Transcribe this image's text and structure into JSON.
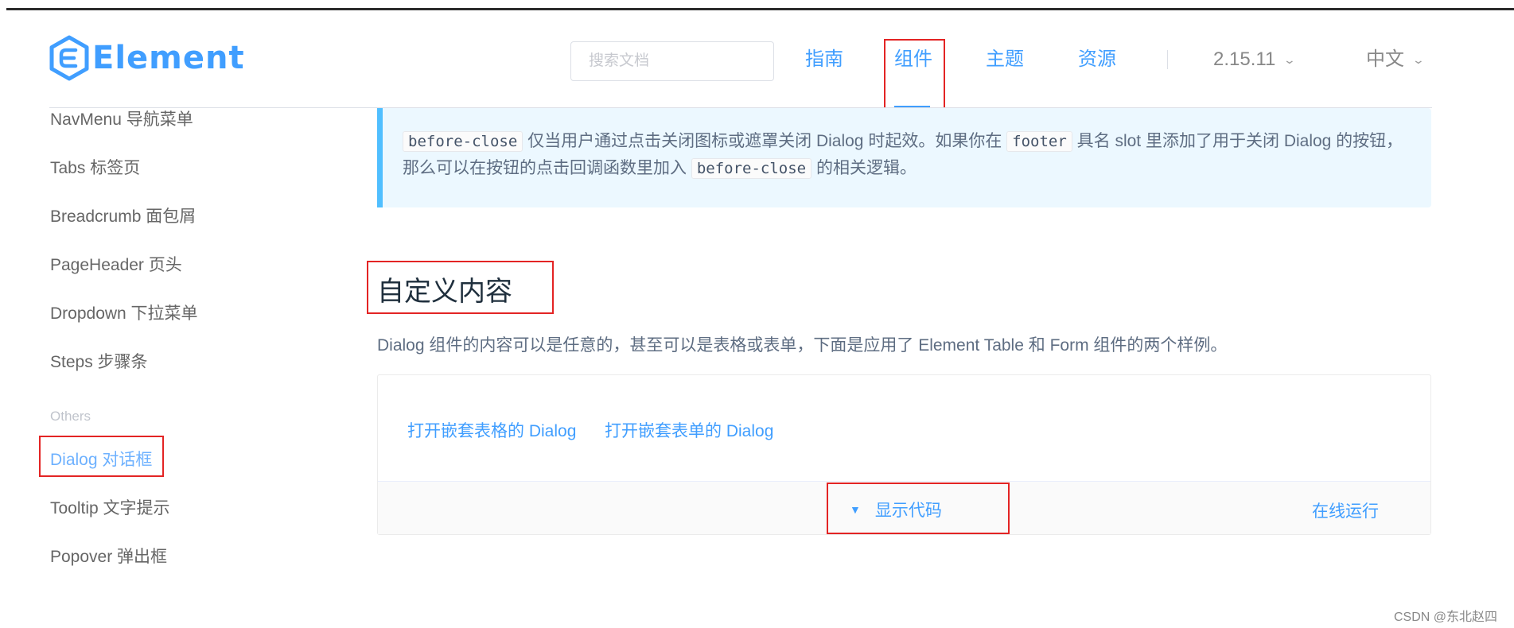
{
  "header": {
    "logo_text": "Element",
    "search_placeholder": "搜索文档",
    "nav": [
      {
        "label": "指南"
      },
      {
        "label": "组件",
        "active": true
      },
      {
        "label": "主题"
      },
      {
        "label": "资源"
      }
    ],
    "version": "2.15.11",
    "language": "中文"
  },
  "sidebar": {
    "items": [
      {
        "label": "NavMenu 导航菜单"
      },
      {
        "label": "Tabs 标签页"
      },
      {
        "label": "Breadcrumb 面包屑"
      },
      {
        "label": "PageHeader 页头"
      },
      {
        "label": "Dropdown 下拉菜单"
      },
      {
        "label": "Steps 步骤条"
      }
    ],
    "group_title": "Others",
    "others": [
      {
        "label": "Dialog 对话框",
        "active": true
      },
      {
        "label": "Tooltip 文字提示"
      },
      {
        "label": "Popover 弹出框"
      }
    ]
  },
  "tip": {
    "code1": "before-close",
    "text1": " 仅当用户通过点击关闭图标或遮罩关闭 Dialog 时起效。如果你在 ",
    "code2": "footer",
    "text2": " 具名 slot 里添加了用于关闭 Dialog 的按钮，那么可以在按钮的点击回调函数里加入 ",
    "code3": "before-close",
    "text3": " 的相关逻辑。"
  },
  "section": {
    "title": "自定义内容",
    "description": "Dialog 组件的内容可以是任意的，甚至可以是表格或表单，下面是应用了 Element Table 和 Form 组件的两个样例。"
  },
  "demo": {
    "link_table": "打开嵌套表格的 Dialog",
    "link_form": "打开嵌套表单的 Dialog",
    "show_code": "显示代码",
    "run_online": "在线运行"
  },
  "watermark": "CSDN @东北赵四",
  "colors": {
    "brand": "#409eff",
    "tip_bg": "#ecf8ff",
    "tip_border": "#50bfff",
    "highlight_box": "#e32424"
  }
}
